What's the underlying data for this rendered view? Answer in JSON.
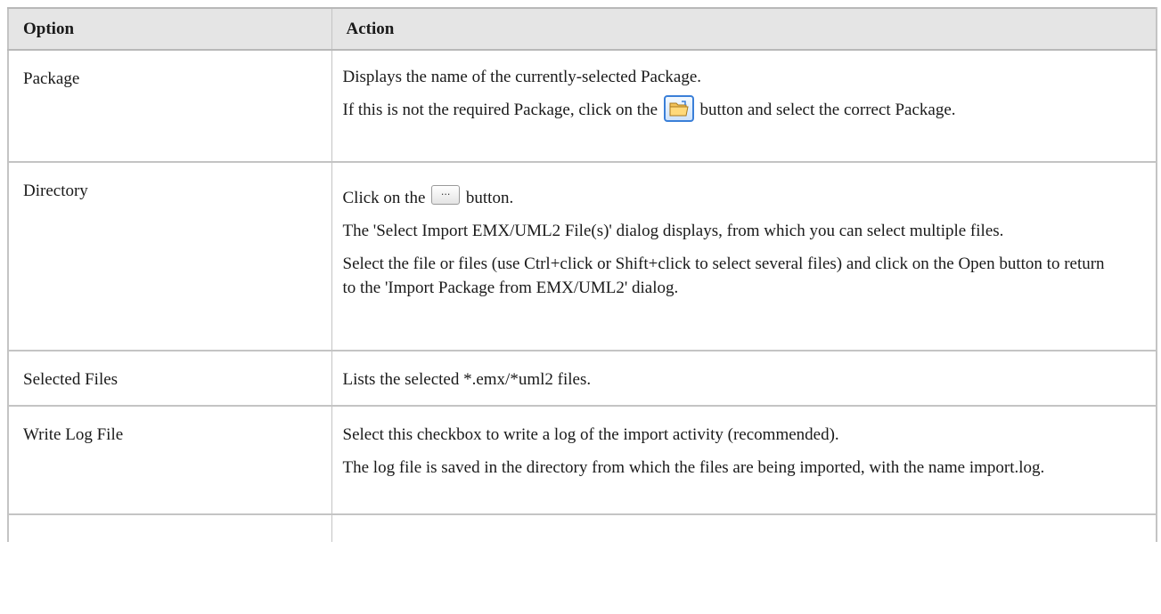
{
  "table": {
    "headers": {
      "option": "Option",
      "action": "Action"
    },
    "rows": [
      {
        "option": "Package",
        "p1": "Displays the name of the currently-selected Package.",
        "p2_before": "If this is not the required Package, click on the",
        "p2_after": "button and select the correct Package.",
        "button_icon": "folder-open-icon"
      },
      {
        "option": "Directory",
        "p1_before": "Click on the",
        "p1_after": "button.",
        "button_text": "...",
        "p2": "The 'Select Import EMX/UML2 File(s)' dialog displays, from which you can select multiple files.",
        "p3": "Select the file or files (use Ctrl+click or Shift+click to select several files) and click on the Open button to return to the 'Import Package from EMX/UML2' dialog."
      },
      {
        "option": "Selected Files",
        "p1": "Lists the selected *.emx/*uml2 files."
      },
      {
        "option": "Write Log File",
        "p1": "Select this checkbox to write a log of the import activity (recommended).",
        "p2": "The log file is saved in the directory from which the files are being imported, with the name import.log."
      }
    ]
  }
}
